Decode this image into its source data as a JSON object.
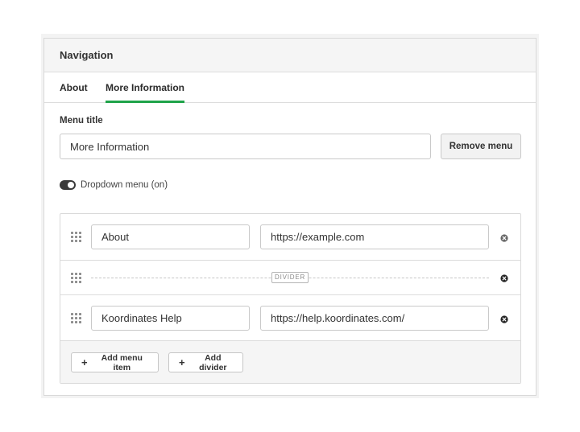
{
  "panel": {
    "title": "Navigation"
  },
  "tabs": [
    {
      "label": "About",
      "active": false
    },
    {
      "label": "More Information",
      "active": true
    }
  ],
  "menu_title": {
    "label": "Menu title",
    "value": "More Information"
  },
  "remove_menu_label": "Remove menu",
  "dropdown_toggle": {
    "label": "Dropdown menu (on)",
    "on": true
  },
  "items": [
    {
      "type": "link",
      "name": "About",
      "url": "https://example.com"
    },
    {
      "type": "divider",
      "label": "DIVIDER"
    },
    {
      "type": "link",
      "name": "Koordinates Help",
      "url": "https://help.koordinates.com/"
    }
  ],
  "footer": {
    "add_item_label": "Add menu item",
    "add_divider_label": "Add divider"
  },
  "colors": {
    "accent": "#1fa34a",
    "toggle_on": "#3a3a3a"
  },
  "icons": {
    "drag": "drag-handle-icon",
    "remove": "close-circle-icon",
    "add": "plus-icon"
  }
}
